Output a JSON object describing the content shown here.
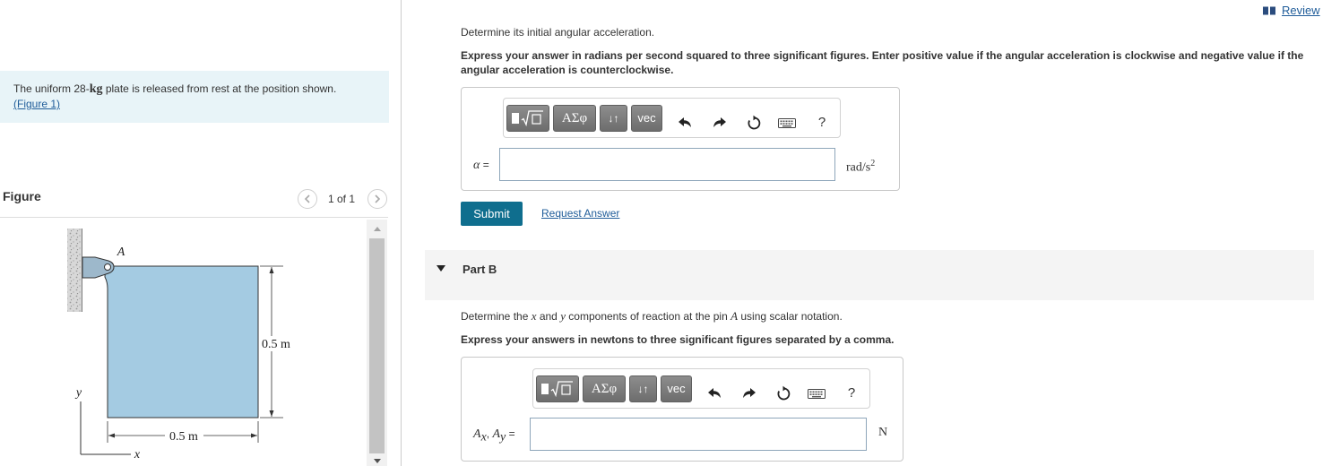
{
  "colors": {
    "problem_bg": "#e8f4f8",
    "link": "#1f5c99",
    "submit_bg": "#0f6e8e",
    "plate_fill": "#a4cbe2",
    "part_header_bg": "#f4f4f4"
  },
  "header": {
    "review_label": "Review",
    "review_icon": "book-icon"
  },
  "problem": {
    "text_before": "The uniform 28-",
    "mass_unit": "kg",
    "text_after": " plate is released from rest at the position shown.",
    "figure_link": "(Figure 1)"
  },
  "figure_panel": {
    "heading": "Figure",
    "pager_text": "1 of 1",
    "prev_icon": "chevron-left-icon",
    "next_icon": "chevron-right-icon",
    "diagram_labels": {
      "pin": "A",
      "height": "0.5 m",
      "width": "0.5 m",
      "y_axis": "y",
      "x_axis": "x"
    }
  },
  "toolbar": {
    "templates_icon": "templates-icon",
    "greek_label": "ΑΣφ",
    "arrows_label": "↓↑",
    "vec_label": "vec",
    "undo_icon": "undo-icon",
    "redo_icon": "redo-icon",
    "reset_icon": "reset-icon",
    "keyboard_icon": "keyboard-icon",
    "help_label": "?"
  },
  "part_a": {
    "instruction": "Determine its initial angular acceleration.",
    "express": "Express your answer in radians per second squared to three significant figures. Enter positive value if the angular acceleration is clockwise and negative value if the angular acceleration is counterclockwise.",
    "answer": {
      "symbol": "α",
      "equals": " =",
      "value": "",
      "unit": "rad/s",
      "unit_exponent": "2"
    },
    "submit_label": "Submit",
    "request_answer_label": "Request Answer"
  },
  "part_b": {
    "title": "Part B",
    "expanded_icon": "caret-down-icon",
    "instruction": {
      "t1": "Determine the ",
      "x": "x",
      "t2": " and ",
      "y": "y",
      "t3": " components of reaction at the pin ",
      "pin": "A",
      "t4": " using scalar notation."
    },
    "express": "Express your answers in newtons to three significant figures separated by a comma.",
    "answer": {
      "var1": "A",
      "sub1": "x",
      "separator": ", ",
      "var2": "A",
      "sub2": "y",
      "equals": " =",
      "value": "",
      "unit": "N"
    }
  }
}
